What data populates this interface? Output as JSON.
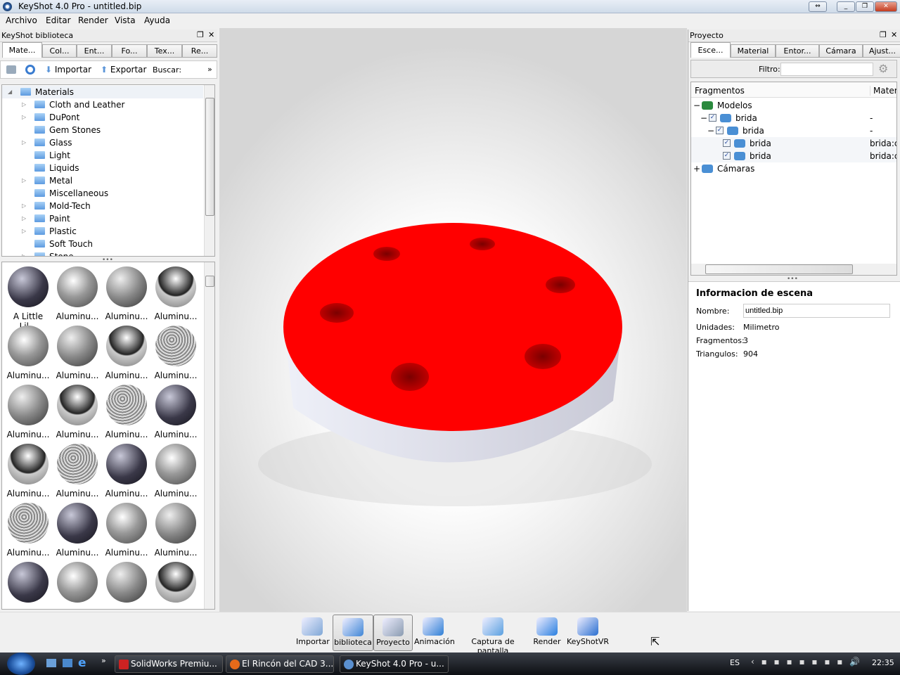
{
  "window": {
    "title": "KeyShot 4.0 Pro  - untitled.bip"
  },
  "menu": [
    "Archivo",
    "Editar",
    "Render",
    "Vista",
    "Ayuda"
  ],
  "library": {
    "title": "KeyShot biblioteca",
    "tabs": [
      "Mate...",
      "Col...",
      "Ent...",
      "Fo...",
      "Tex...",
      "Re..."
    ],
    "toolbar": {
      "import": "Importar",
      "export": "Exportar",
      "search": "Buscar:",
      "more": "»"
    },
    "tree_root": "Materials",
    "tree": [
      {
        "label": "Cloth and Leather",
        "exp": true
      },
      {
        "label": "DuPont",
        "exp": true
      },
      {
        "label": "Gem Stones",
        "exp": false
      },
      {
        "label": "Glass",
        "exp": true
      },
      {
        "label": "Light",
        "exp": false
      },
      {
        "label": "Liquids",
        "exp": false
      },
      {
        "label": "Metal",
        "exp": true
      },
      {
        "label": "Miscellaneous",
        "exp": false
      },
      {
        "label": "Mold-Tech",
        "exp": true
      },
      {
        "label": "Paint",
        "exp": true
      },
      {
        "label": "Plastic",
        "exp": true
      },
      {
        "label": "Soft Touch",
        "exp": false
      },
      {
        "label": "Stone",
        "exp": true
      }
    ],
    "materials": [
      "A Little Lil...",
      "Aluminu...",
      "Aluminu...",
      "Aluminu...",
      "Aluminu...",
      "Aluminu...",
      "Aluminu...",
      "Aluminu...",
      "Aluminu...",
      "Aluminu...",
      "Aluminu...",
      "Aluminu...",
      "Aluminu...",
      "Aluminu...",
      "Aluminu...",
      "Aluminu...",
      "Aluminu...",
      "Aluminu...",
      "Aluminu...",
      "Aluminu...",
      "",
      "",
      "",
      ""
    ]
  },
  "project": {
    "title": "Proyecto",
    "tabs": [
      "Esce...",
      "Material",
      "Entor...",
      "Cámara",
      "Ajust..."
    ],
    "filter_label": "Filtro:",
    "filter_value": "",
    "columns": [
      "Fragmentos",
      "Materia"
    ],
    "tree": [
      {
        "label": "Modelos",
        "mat": "",
        "indent": 0,
        "toggle": "−",
        "check": false
      },
      {
        "label": "brida",
        "mat": "-",
        "indent": 1,
        "toggle": "−",
        "check": true
      },
      {
        "label": "brida",
        "mat": "-",
        "indent": 2,
        "toggle": "−",
        "check": true
      },
      {
        "label": "brida",
        "mat": "brida:c",
        "indent": 3,
        "toggle": "",
        "check": true
      },
      {
        "label": "brida",
        "mat": "brida:c",
        "indent": 3,
        "toggle": "",
        "check": true
      },
      {
        "label": "Cámaras",
        "mat": "",
        "indent": 0,
        "toggle": "+",
        "check": false
      }
    ],
    "info": {
      "heading": "Informacion de escena",
      "name_label": "Nombre:",
      "name_value": "untitled.bip",
      "units_label": "Unidades:",
      "units_value": "Milimetro",
      "frag_label": "Fragmentos:",
      "frag_value": "3",
      "tri_label": "Triangulos:",
      "tri_value": "904"
    }
  },
  "toolbar": [
    "Importar",
    "biblioteca",
    "Proyecto",
    "Animación",
    "Captura de pantalla",
    "Render",
    "KeyShotVR"
  ],
  "taskbar": {
    "tasks": [
      "SolidWorks Premiu...",
      "El Rincón del CAD 3...",
      "KeyShot 4.0 Pro  - u..."
    ],
    "lang": "ES",
    "clock": "22:35"
  },
  "colors": {
    "model_top": "#ff0000",
    "model_side": "#dcdde8"
  }
}
